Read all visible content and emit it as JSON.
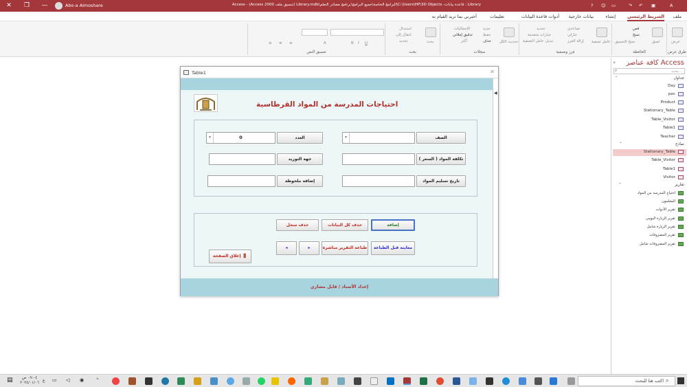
{
  "window": {
    "title": "Library : قاعدة بيانات- C:\\Users\\HP\\3D Objects\\البرامج الخاصة\\جميع البرامج\\برنامج مصادر التعلم\\Library.mdb (تنسيق ملف Access 2000) - Access",
    "user": "Abo-a Almoshare"
  },
  "tabs": [
    "ملف",
    "الشريط الرئيسي",
    "إنشاء",
    "بيانات خارجية",
    "أدوات قاعدة البيانات",
    "تعليمات",
    "أخبرني بما تريد القيام به"
  ],
  "ribbon": {
    "groups": [
      "طرق عرض",
      "الحافظة",
      "فرز وتصفية",
      "سجلات",
      "بحث",
      "تنسيق النص"
    ],
    "view": "عرض",
    "cut": "قص",
    "copy": "نسخ",
    "painter": "نسخ التنسيق",
    "paste": "لصق",
    "filter": "عامل تصفية",
    "asc": "تصاعدي",
    "desc": "تنازلي",
    "remove_sort": "إزالة الفرز",
    "selection": "تحديد",
    "advanced": "خيارات متقدمة",
    "toggle": "تبديل عامل التصفية",
    "new": "جديد",
    "save": "حفظ",
    "delete": "حذف",
    "refresh": "تحديث الكل",
    "totals": "الإجماليات",
    "spelling": "تدقيق إملائي",
    "more": "أكثر",
    "find": "بحث",
    "replace": "استبدال",
    "goto": "انتقال إلى",
    "select": "تحديد"
  },
  "nav": {
    "title": "كافة عناصر Access",
    "search": "بحث...",
    "tables_label": "جداول",
    "tables": [
      "Day",
      "pec",
      "Product",
      "Stationary_Table",
      "Table_Visitor",
      "Table1",
      "Teacher"
    ],
    "forms_label": "نماذج",
    "forms": [
      "Stationary_Table",
      "Table_Visitor",
      "Table1",
      "Visitor"
    ],
    "reports_label": "تقارير",
    "reports": [
      "احتياج المدرسة من المواد",
      "المعلمون",
      "تقرير الأدوات",
      "تقرير الزيارة اليومي",
      "تقرير الزيارة شامل",
      "تقرير المصروفات",
      "تقرير المصروفات شامل"
    ]
  },
  "form": {
    "window_title": "Table1",
    "heading": "احتياجات المدرسة من المواد القرطاسية",
    "grade_label": "الصف",
    "count_label": "العدد",
    "count_value": "0",
    "cost_label": "تكلفة المواد ( السعر )",
    "supplier_label": "جهة التوريد",
    "delivery_label": "تاريخ تسليم المواد",
    "note_label": "إضافة ملحوظة",
    "add": "إضافة",
    "delete_all": "حذف كل البيانات",
    "delete_record": "حذف سجل",
    "preview": "معاينة قبل الطباعة",
    "print_direct": "طباعة التقرير مباشرة",
    "next": "▸",
    "prev": "◂",
    "close": "إغلاق الصفحة",
    "credit": "إعداد الأستاذ / قايل مشاري"
  },
  "taskbar": {
    "search": "اكتب هنا للبحث",
    "time": "٠٩:٠٤ ص",
    "date": "٢٠٢٤/٠١/٠٦",
    "lang": "ع"
  },
  "colors": {
    "accent": "#a4373a",
    "band": "#a7d4df",
    "formbg": "#eef7f8",
    "heading": "#b0302c"
  }
}
